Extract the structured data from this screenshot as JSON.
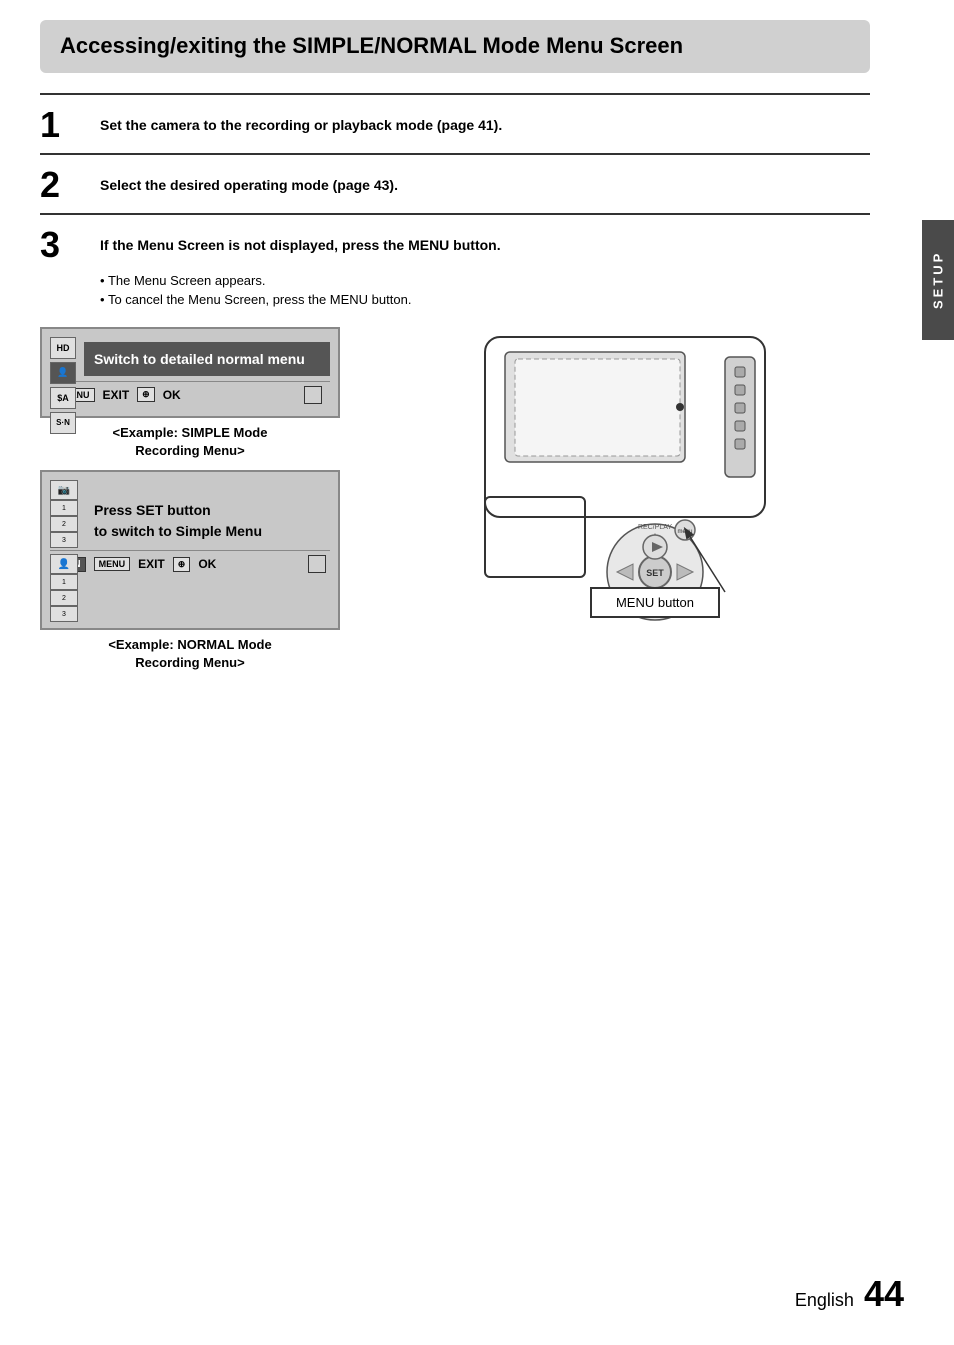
{
  "title": "Accessing/exiting the SIMPLE/NORMAL Mode Menu Screen",
  "setup_tab": "SETUP",
  "steps": [
    {
      "number": "1",
      "text": "Set the camera to the recording or playback mode (page 41)."
    },
    {
      "number": "2",
      "text": "Select the desired operating mode (page 43)."
    },
    {
      "number": "3",
      "text": "If the Menu Screen is not displayed, press the MENU button.",
      "bullets": [
        "The Menu Screen appears.",
        "To cancel the Menu Screen, press the MENU button."
      ]
    }
  ],
  "simple_mode": {
    "menu_item": "Switch to detailed normal menu",
    "icons": [
      "HD",
      "👤",
      "$A",
      "S·N"
    ],
    "bottom_bar_exit": "EXIT",
    "bottom_bar_ok": "OK",
    "caption_line1": "<Example: SIMPLE Mode",
    "caption_line2": "Recording Menu>"
  },
  "normal_mode": {
    "menu_text_line1": "Press SET button",
    "menu_text_line2": "to switch to Simple Menu",
    "bottom_bar_exit": "EXIT",
    "bottom_bar_ok": "OK",
    "caption_line1": "<Example: NORMAL Mode",
    "caption_line2": "Recording Menu>"
  },
  "menu_button_label": "MENU button",
  "footer": {
    "language": "English",
    "page_number": "44"
  }
}
